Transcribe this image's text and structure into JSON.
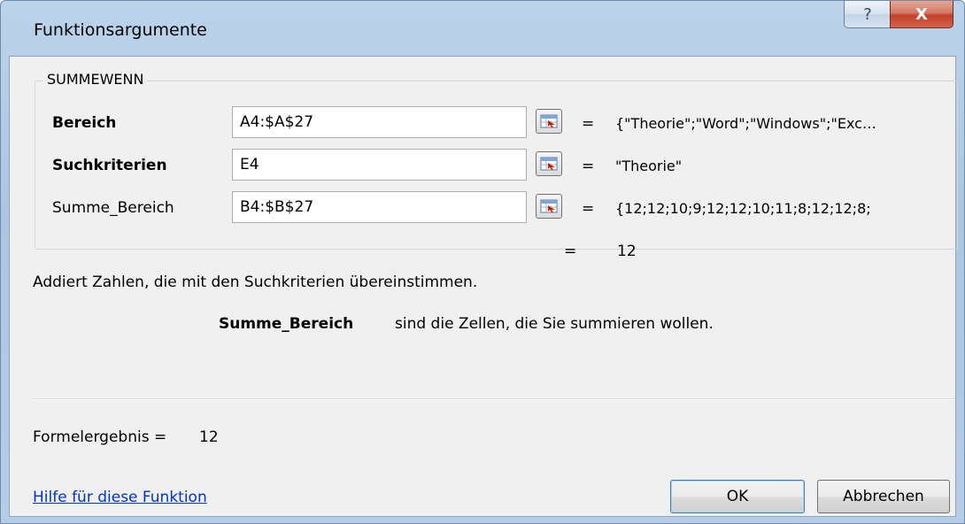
{
  "window": {
    "title": "Funktionsargumente",
    "help_glyph": "?",
    "close_glyph": "X"
  },
  "function": {
    "name": "SUMMEWENN",
    "arguments": [
      {
        "label": "Bereich",
        "bold": true,
        "input": "A4:$A$27",
        "equals": "=",
        "value": "{\"Theorie\";\"Word\";\"Windows\";\"Exc…"
      },
      {
        "label": "Suchkriterien",
        "bold": true,
        "input": "E4",
        "equals": "=",
        "value": "\"Theorie\""
      },
      {
        "label": "Summe_Bereich",
        "bold": false,
        "input": "B4:$B$27",
        "equals": "=",
        "value": "{12;12;10;9;12;12;10;11;8;12;12;8;"
      }
    ],
    "result_equals": "=",
    "result": "12",
    "description": "Addiert Zahlen, die mit den Suchkriterien übereinstimmen.",
    "param_name": "Summe_Bereich",
    "param_description": "sind die Zellen, die Sie summieren wollen."
  },
  "footer": {
    "formula_label": "Formelergebnis =",
    "formula_result": "12",
    "help_link": "Hilfe für diese Funktion",
    "ok_label": "OK",
    "cancel_label": "Abbrechen"
  },
  "icons": {
    "ref_button": "collapse-dialog-icon"
  }
}
